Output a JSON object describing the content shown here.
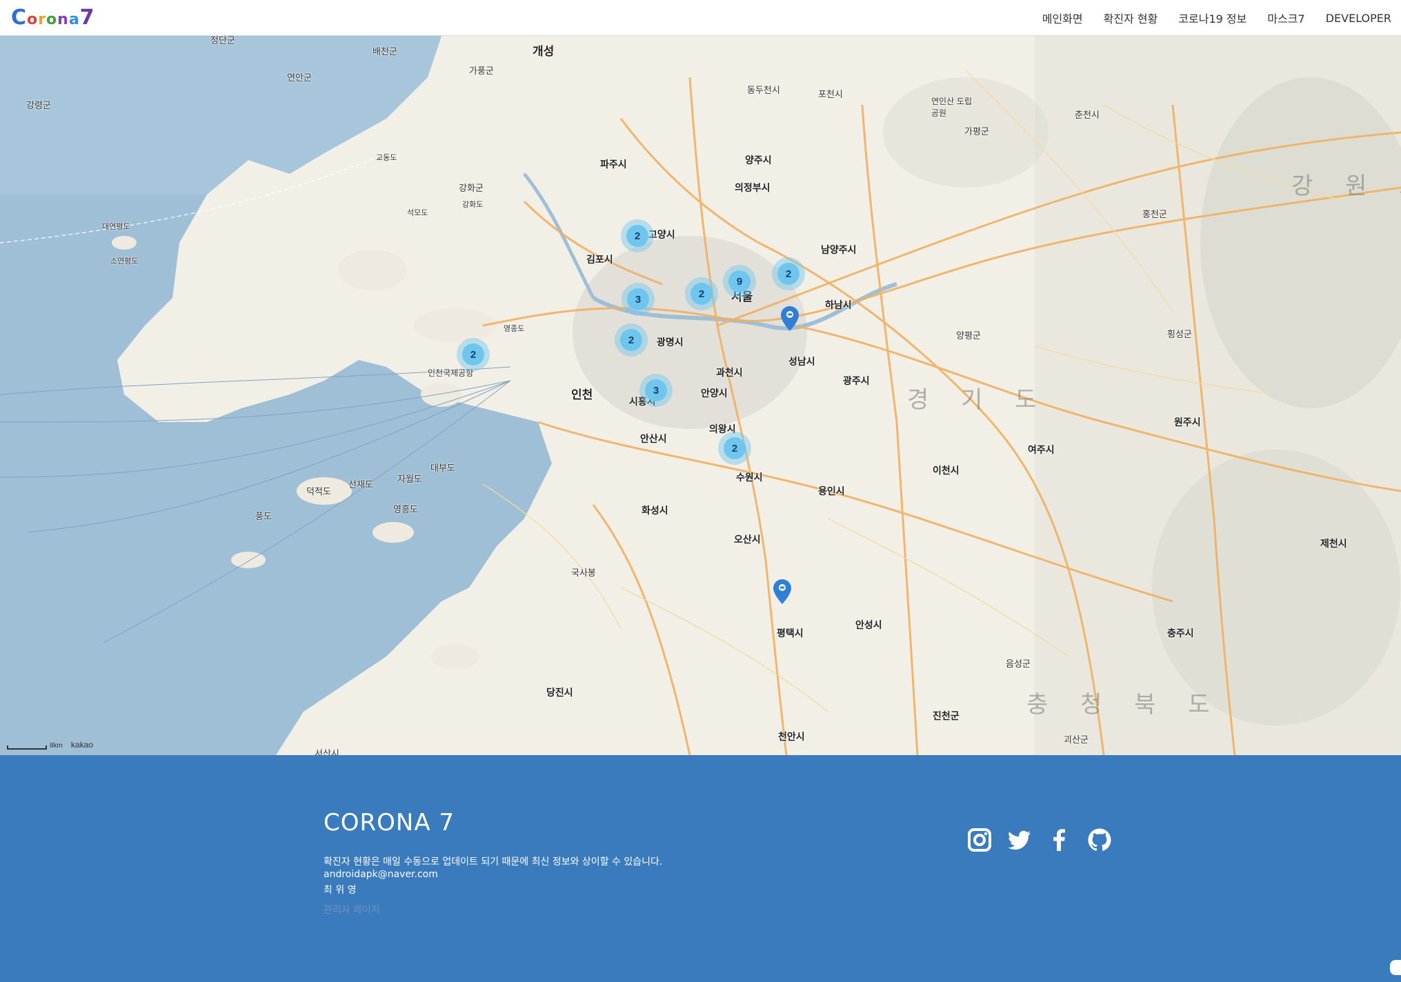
{
  "brand": {
    "letters": [
      "C",
      "o",
      "r",
      "o",
      "n",
      "a",
      "7"
    ],
    "colors": [
      "#2f6fd1",
      "#e04040",
      "#f0a020",
      "#40a040",
      "#8a3cc0",
      "#3090e0",
      "#6a3aa0"
    ]
  },
  "nav": {
    "items": [
      "메인화면",
      "확진자 현황",
      "코로나19 정보",
      "마스크7",
      "DEVELOPER"
    ]
  },
  "map": {
    "region_labels": {
      "gangwon": "강 원 도",
      "gyeonggi": "경 기 도",
      "chungbuk": "충 청 북 도"
    },
    "places": [
      "정단군",
      "배천군",
      "개성",
      "연안군",
      "가풍군",
      "강령군",
      "동두천시",
      "포천시",
      "연인산 도립공원",
      "가평군",
      "춘천시",
      "파주시",
      "양주시",
      "의정부시",
      "강화군",
      "강화도",
      "교동도",
      "석모도",
      "대연평도",
      "소연평도",
      "고양시",
      "김포시",
      "남양주시",
      "홍천군",
      "서울",
      "하남시",
      "인천국제공항",
      "영종도",
      "인천",
      "광명시",
      "과천시",
      "성남시",
      "광주시",
      "시흥시",
      "안양시",
      "안산시",
      "의왕시",
      "수원시",
      "용인시",
      "이천시",
      "여주시",
      "원주시",
      "양평군",
      "횡성군",
      "화성시",
      "오산시",
      "평택시",
      "안성시",
      "음성군",
      "충주시",
      "제천시",
      "당진시",
      "천안시",
      "진천군",
      "괴산군",
      "대부도",
      "덕적도",
      "자월도",
      "선재도",
      "영흥도",
      "풍도",
      "국사봉",
      "서산시"
    ],
    "scale_label": "8km",
    "provider": "kakao",
    "clusters": [
      "2",
      "3",
      "2",
      "9",
      "2",
      "2",
      "2",
      "3",
      "2"
    ]
  },
  "footer": {
    "title": "CORONA 7",
    "notice": "확진자 현황은 매일 수동으로 업데이트 되기 때문에 최신 정보와 상이할 수 있습니다.",
    "email": "androidapk@naver.com",
    "author": "최 위 영",
    "admin_link": "관리자 페이지",
    "social_icons": [
      "instagram-icon",
      "twitter-icon",
      "facebook-icon",
      "github-icon"
    ]
  }
}
